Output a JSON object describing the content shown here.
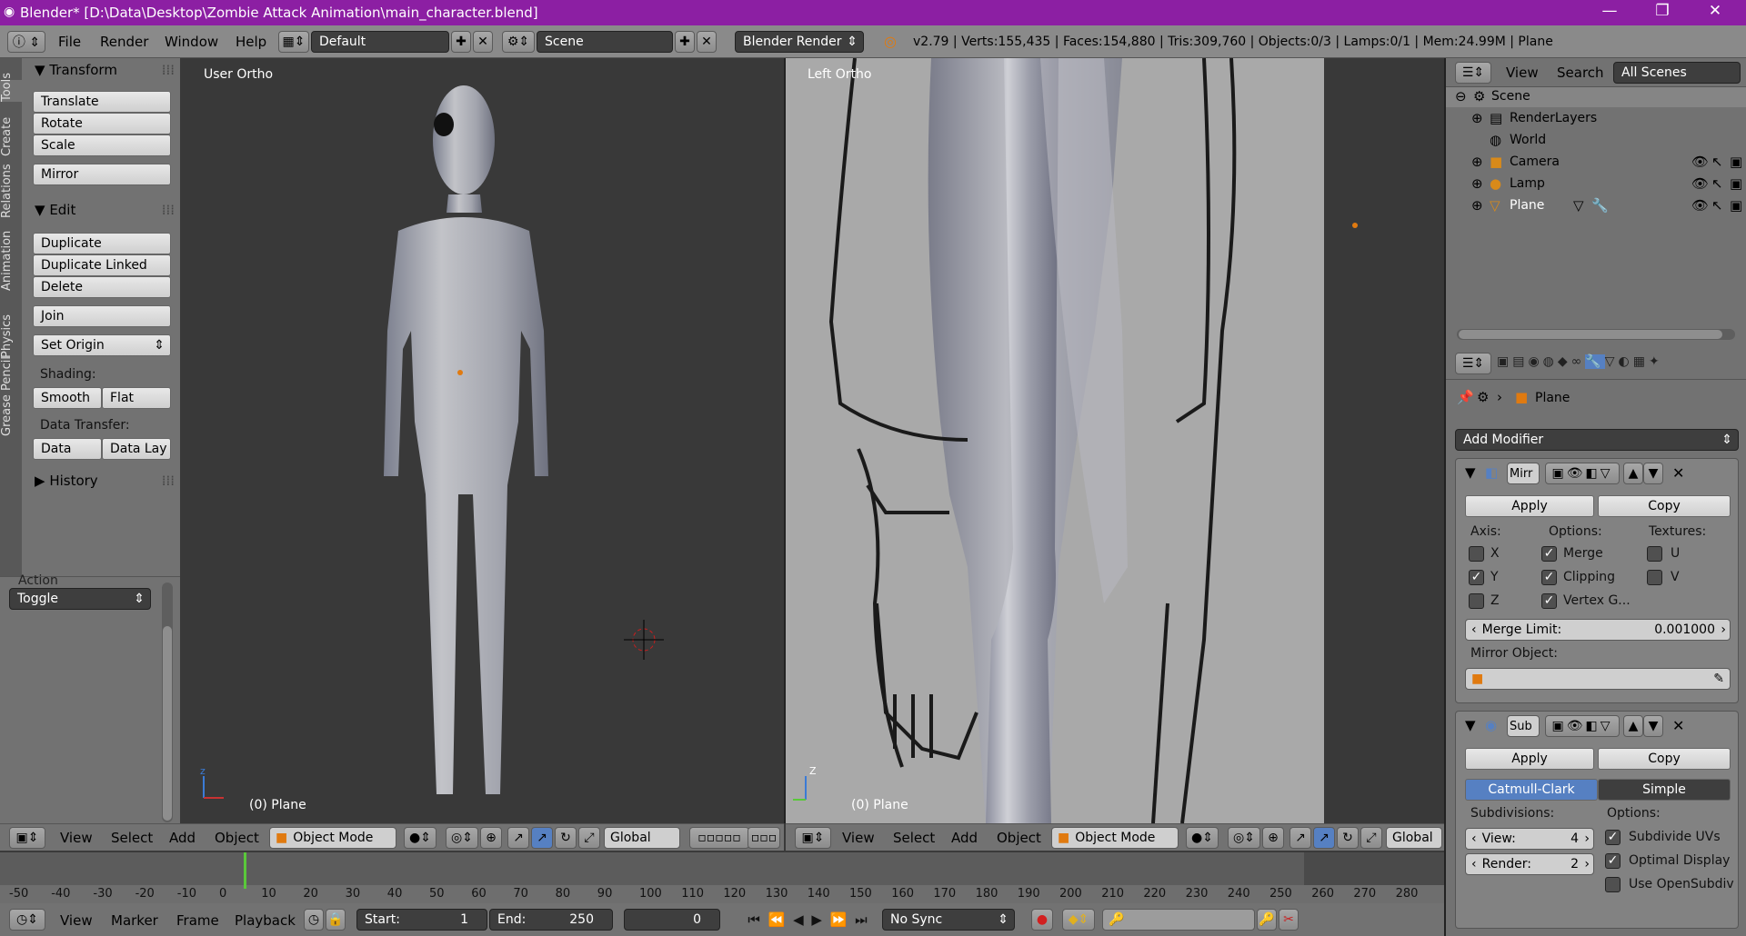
{
  "titlebar": {
    "title": "Blender* [D:\\Data\\Desktop\\Zombie Attack Animation\\main_character.blend]",
    "minimize": "—",
    "maximize": "❐",
    "close": "✕"
  },
  "infobar": {
    "menus": [
      "File",
      "Render",
      "Window",
      "Help"
    ],
    "layout": "Default",
    "scene": "Scene",
    "engine": "Blender Render",
    "stats": "v2.79 | Verts:155,435 | Faces:154,880 | Tris:309,760 | Objects:0/3 | Lamps:0/1 | Mem:24.99M | Plane"
  },
  "toolshelf": {
    "tabs": [
      "Tools",
      "Create",
      "Relations",
      "Animation",
      "Physics",
      "Grease Pencil"
    ],
    "transform_title": "Transform",
    "translate": "Translate",
    "rotate": "Rotate",
    "scale": "Scale",
    "mirror": "Mirror",
    "edit_title": "Edit",
    "duplicate": "Duplicate",
    "duplicate_linked": "Duplicate Linked",
    "delete": "Delete",
    "join": "Join",
    "set_origin": "Set Origin",
    "shading_label": "Shading:",
    "smooth": "Smooth",
    "flat": "Flat",
    "data_transfer_label": "Data Transfer:",
    "data": "Data",
    "data_lay": "Data Lay",
    "history_title": "History",
    "action_label": "Action",
    "toggle": "Toggle"
  },
  "viewport_left": {
    "view_label": "User Ortho",
    "object_label": "(0) Plane"
  },
  "viewport_right": {
    "view_label": "Left Ortho",
    "object_label": "(0) Plane"
  },
  "viewport_header": {
    "menus": [
      "View",
      "Select",
      "Add",
      "Object"
    ],
    "mode": "Object Mode",
    "orientation": "Global"
  },
  "timeline": {
    "ticks": [
      "-50",
      "-40",
      "-30",
      "-20",
      "-10",
      "0",
      "10",
      "20",
      "30",
      "40",
      "50",
      "60",
      "70",
      "80",
      "90",
      "100",
      "110",
      "120",
      "130",
      "140",
      "150",
      "160",
      "170",
      "180",
      "190",
      "200",
      "210",
      "220",
      "230",
      "240",
      "250",
      "260",
      "270",
      "280"
    ]
  },
  "timeline_bar": {
    "menus": [
      "View",
      "Marker",
      "Frame",
      "Playback"
    ],
    "start_label": "Start:",
    "start": "1",
    "end_label": "End:",
    "end": "250",
    "current": "0",
    "sync": "No Sync"
  },
  "outliner": {
    "menus": [
      "View",
      "Search"
    ],
    "scenes": "All Scenes",
    "items": [
      "Scene",
      "RenderLayers",
      "World",
      "Camera",
      "Lamp",
      "Plane"
    ]
  },
  "properties": {
    "object_name": "Plane",
    "add_modifier": "Add Modifier",
    "mirror": {
      "name": "Mirr",
      "apply": "Apply",
      "copy": "Copy",
      "axis_label": "Axis:",
      "options_label": "Options:",
      "textures_label": "Textures:",
      "x": "X",
      "y": "Y",
      "z": "Z",
      "merge": "Merge",
      "clipping": "Clipping",
      "vertex_groups": "Vertex G...",
      "u": "U",
      "v": "V",
      "merge_limit_label": "Merge Limit:",
      "merge_limit": "0.001000",
      "mirror_object_label": "Mirror Object:"
    },
    "subsurf": {
      "name": "Sub",
      "apply": "Apply",
      "copy": "Copy",
      "catmull": "Catmull-Clark",
      "simple": "Simple",
      "subdivisions_label": "Subdivisions:",
      "options_label": "Options:",
      "view_label": "View:",
      "view": "4",
      "render_label": "Render:",
      "render": "2",
      "subdivide_uvs": "Subdivide UVs",
      "optimal_display": "Optimal Display",
      "use_opensubdiv": "Use OpenSubdiv"
    }
  }
}
